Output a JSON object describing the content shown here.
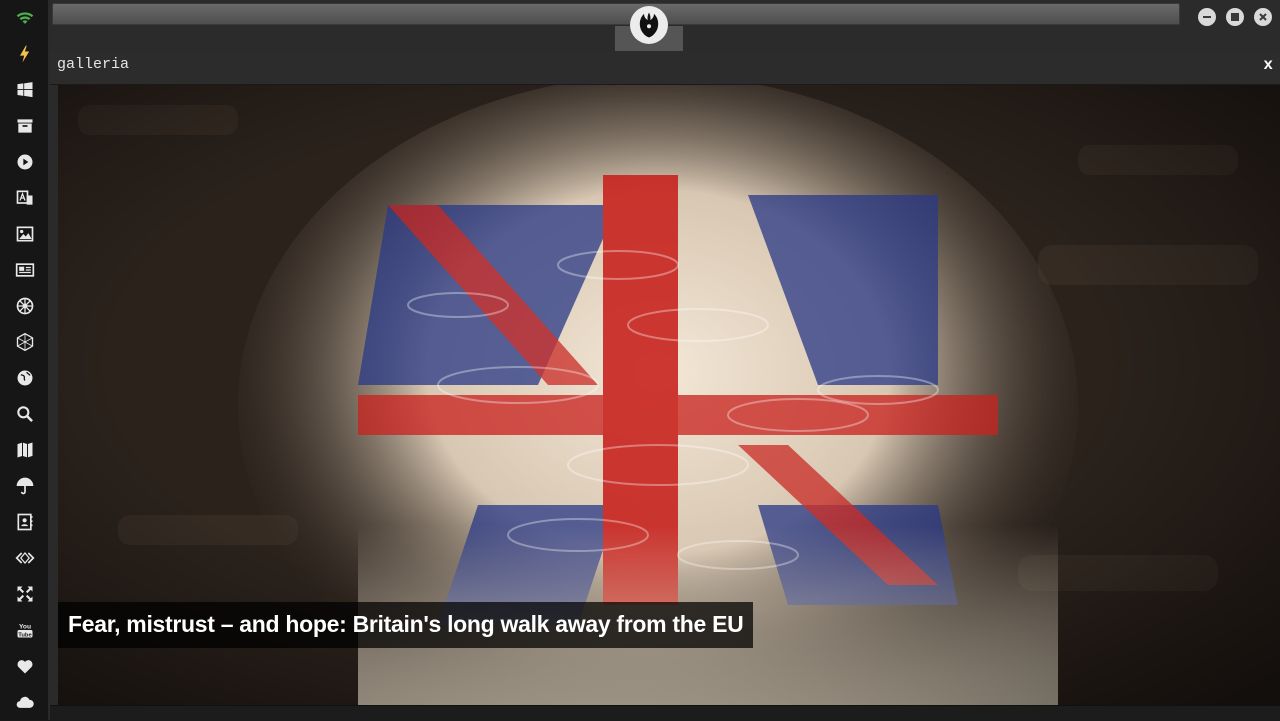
{
  "panel": {
    "title": "galleria",
    "close_label": "x"
  },
  "gallery": {
    "caption": "Fear, mistrust – and hope: Britain's long walk away from the EU"
  },
  "sidebar": {
    "items": [
      {
        "icon": "wifi-icon"
      },
      {
        "icon": "lightning-icon"
      },
      {
        "icon": "windows-icon"
      },
      {
        "icon": "archive-icon"
      },
      {
        "icon": "play-icon"
      },
      {
        "icon": "translate-icon"
      },
      {
        "icon": "image-icon"
      },
      {
        "icon": "newspaper-icon"
      },
      {
        "icon": "empire-icon"
      },
      {
        "icon": "hexagon-icon"
      },
      {
        "icon": "globe-icon"
      },
      {
        "icon": "search-icon"
      },
      {
        "icon": "map-icon"
      },
      {
        "icon": "umbrella-icon"
      },
      {
        "icon": "contacts-icon"
      },
      {
        "icon": "code-icon"
      },
      {
        "icon": "fullscreen-icon"
      },
      {
        "icon": "youtube-icon"
      },
      {
        "icon": "heart-icon"
      },
      {
        "icon": "cloud-icon"
      }
    ]
  },
  "colors": {
    "accent_wifi": "#4caf50",
    "accent_lightning": "#f2c14e",
    "flag_red": "#c8231f",
    "flag_blue": "#2a3a86"
  }
}
